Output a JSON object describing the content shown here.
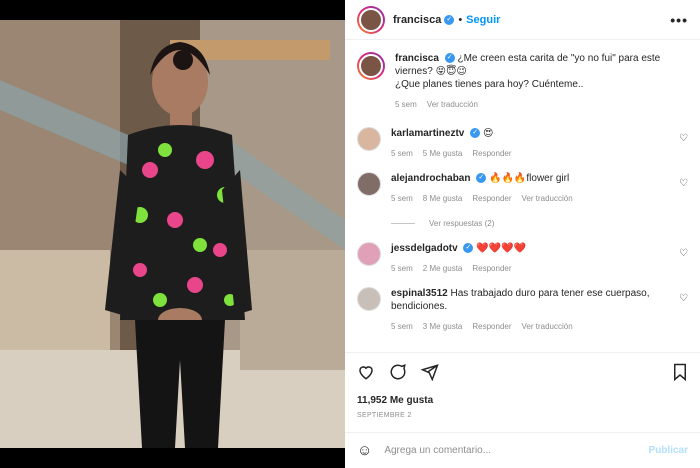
{
  "post": {
    "username": "francisca",
    "follow_label": "Seguir",
    "more_label": "•••",
    "caption_user": "francisca",
    "caption_text": "¿Me creen esta carita de \"yo no fui\" para este viernes? 😝😇😉",
    "caption_text2": "¿Que planes tienes para hoy? Cuénteme..",
    "caption_time": "5 sem",
    "caption_translate": "Ver traducción"
  },
  "comments": [
    {
      "user": "karlamartineztv",
      "text": "😍",
      "time": "5 sem",
      "likes": "5 Me gusta",
      "reply": "Responder",
      "translate": ""
    },
    {
      "user": "alejandrochaban",
      "text": "🔥🔥🔥flower girl",
      "time": "5 sem",
      "likes": "8 Me gusta",
      "reply": "Responder",
      "translate": "Ver traducción"
    },
    {
      "user": "jessdelgadotv",
      "text": "❤️❤️❤️❤️",
      "time": "5 sem",
      "likes": "2 Me gusta",
      "reply": "Responder",
      "translate": ""
    },
    {
      "user": "espinal3512",
      "text": "Has trabajado duro para tener ese cuerpaso, bendiciones.",
      "time": "5 sem",
      "likes": "3 Me gusta",
      "reply": "Responder",
      "translate": "Ver traducción"
    }
  ],
  "replies_label": "Ver respuestas (2)",
  "stats": {
    "likes": "11,952 Me gusta",
    "date": "SEPTIEMBRE 2"
  },
  "composer": {
    "placeholder": "Agrega un comentario...",
    "publish": "Publicar"
  },
  "icons": {
    "like": "heart-icon",
    "comment": "comment-icon",
    "share": "share-icon",
    "save": "bookmark-icon",
    "emoji": "smiley-icon"
  },
  "colors": {
    "accent": "#0095f6",
    "verified": "#3897f0",
    "muted": "#8e8e8e",
    "publish_disabled": "#b2dffc"
  }
}
